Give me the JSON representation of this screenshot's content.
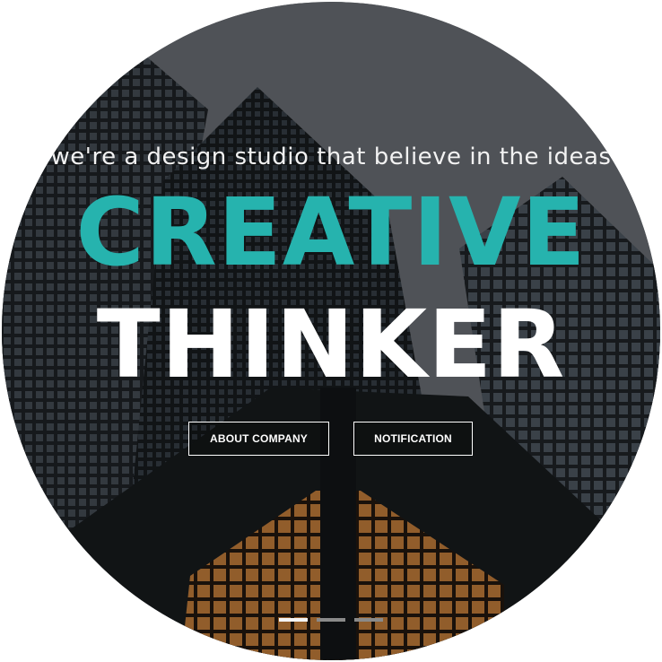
{
  "hero": {
    "tagline": "we're a design studio that believe in the ideas",
    "headline_line1": "CREATIVE",
    "headline_line2": "THINKER",
    "accent_color": "#26b3ae",
    "buttons": [
      {
        "label": "ABOUT COMPANY"
      },
      {
        "label": "NOTIFICATION"
      }
    ],
    "slider": {
      "slides": 3,
      "active_index": 0
    }
  }
}
